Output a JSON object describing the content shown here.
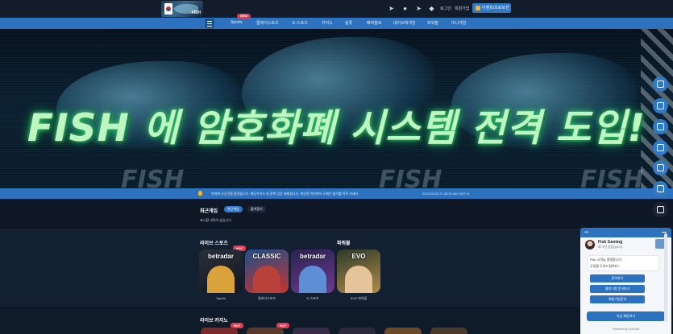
{
  "header": {
    "logo_text": "FISH",
    "links": [
      "로그인",
      "회원가입"
    ],
    "event_button": "이벤트/프로모션",
    "icons": [
      "telegram-icon",
      "chat-icon",
      "telegram-icon",
      "game-icon"
    ]
  },
  "nav": {
    "new_badge": "NEW",
    "items": [
      "Sports",
      "클래식스포츠",
      "E-스포츠",
      "카지노",
      "슬롯",
      "빠찌블로",
      "네이브레게임",
      "파워볼",
      "미니게임"
    ]
  },
  "hero": {
    "title": "FISH 에 암호화폐 시스템 전격 도입!",
    "watermark": "FISH"
  },
  "marquee": {
    "text": "피쉬에 오신것을 환영합니다. 베팅가이드 와 중복 입장 제재됩니다. 최신정 피쉬에서 도메인 즐기를 쭉쭉 하세요.",
    "time": "2021/08/26 21:36:28 AM GMT+9"
  },
  "recent": {
    "title": "최근게임",
    "chip_active": "최근게임",
    "chip_plain": "즐겨찾기",
    "empty": "표시할 내역이 없습니다"
  },
  "live_sports": {
    "title": "라이브 스포츠",
    "hot": "HOT",
    "tiles": [
      {
        "brand": "betradar",
        "caption": "Sports"
      },
      {
        "brand": "CLASSIC",
        "caption": "클래식스포츠"
      },
      {
        "brand": "betradar",
        "caption": "E-스포츠"
      }
    ]
  },
  "powerball": {
    "title": "파워볼",
    "tiles": [
      {
        "brand": "EVO",
        "caption": "EVO 파워볼"
      }
    ]
  },
  "live_casino": {
    "title": "라이브 카지노",
    "hot": "HOT"
  },
  "chat": {
    "name": "Fish Gaming",
    "subtitle": "로그인 상담(24시)",
    "greeting_1": "Fish 고객님 환영합니다.",
    "greeting_2": "무엇을 도와드릴까요?",
    "buttons": [
      "문의하기",
      "텔레그램 문의하기",
      "회원가입문의"
    ],
    "cta": "지금 채팅하기",
    "powered": "Powered by LiveChat"
  },
  "colors": {
    "primary": "#2c72be",
    "background": "#0f1826",
    "hero_green": "#bff5c0",
    "hot": "#e33b4f"
  }
}
